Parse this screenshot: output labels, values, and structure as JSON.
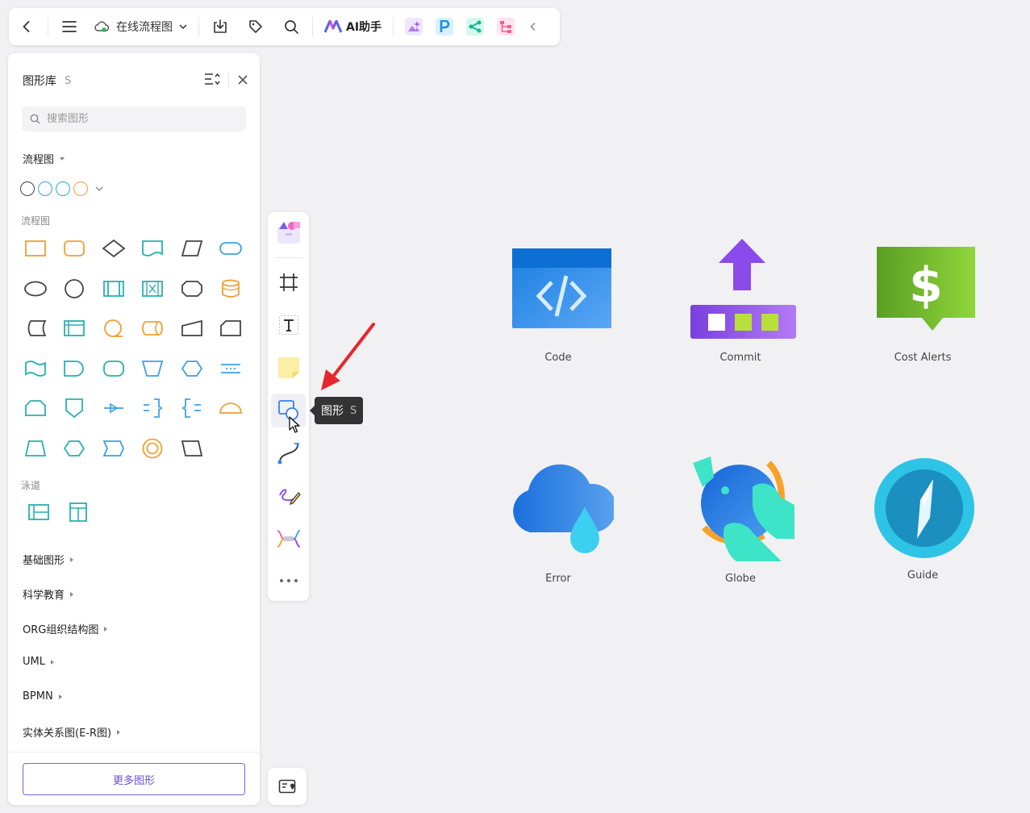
{
  "toolbar": {
    "file_name": "在线流程图",
    "ai_label": "AI助手",
    "icons": [
      "back-icon",
      "menu-icon",
      "cloud-icon",
      "chevron-down-icon",
      "download-icon",
      "tag-icon",
      "search-icon",
      "ai-logo-icon",
      "image-plugin-icon",
      "p-plugin-icon",
      "share-plugin-icon",
      "mindmap-plugin-icon",
      "collapse-icon"
    ]
  },
  "panel": {
    "title": "图形库",
    "shortcut": "S",
    "search_placeholder": "搜索图形",
    "flow_category": "流程图",
    "flow_sub_label": "流程图",
    "swatches": [
      "#444444",
      "#3aa0e8",
      "#26b0b3",
      "#f0a030"
    ],
    "lane_label": "泳道",
    "categories": [
      "基础图形",
      "科学教育",
      "ORG组织结构图",
      "UML",
      "BPMN",
      "实体关系图(E-R图)"
    ],
    "more_button": "更多图形"
  },
  "tooltip": {
    "label": "图形",
    "key": "S"
  },
  "canvas": {
    "icons": [
      {
        "label": "Code"
      },
      {
        "label": "Commit"
      },
      {
        "label": "Cost Alerts"
      },
      {
        "label": "Error"
      },
      {
        "label": "Globe"
      },
      {
        "label": "Guide"
      }
    ]
  }
}
